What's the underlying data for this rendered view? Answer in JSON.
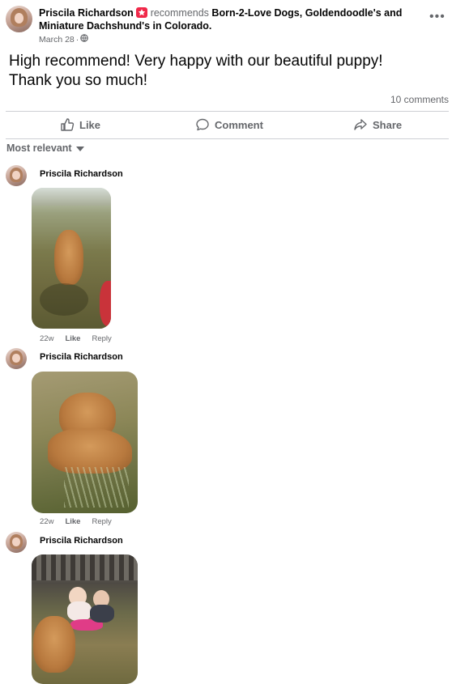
{
  "post": {
    "author": "Priscila Richardson",
    "recommends_word": "recommends",
    "page_name": "Born-2-Love Dogs, Goldendoodle's and",
    "page_name_line2": "Miniature Dachshund's in Colorado.",
    "date": "March 28",
    "text_line1": "High recommend! Very happy with our beautiful puppy!",
    "text_line2": "Thank you so much!",
    "comments_count": "10 comments"
  },
  "actions": {
    "like": "Like",
    "comment": "Comment",
    "share": "Share"
  },
  "sort": {
    "label": "Most relevant"
  },
  "comments": [
    {
      "name": "Priscila Richardson",
      "age": "22w",
      "like": "Like",
      "reply": "Reply"
    },
    {
      "name": "Priscila Richardson",
      "age": "22w",
      "like": "Like",
      "reply": "Reply"
    },
    {
      "name": "Priscila Richardson"
    }
  ],
  "colors": {
    "recommend_badge": "#f02849",
    "link_muted": "#65676b",
    "divider": "#ced0d4"
  },
  "icons": [
    "more-icon",
    "recommend-star-icon",
    "globe-icon",
    "like-icon",
    "comment-icon",
    "share-icon",
    "dropdown-caret-icon"
  ]
}
